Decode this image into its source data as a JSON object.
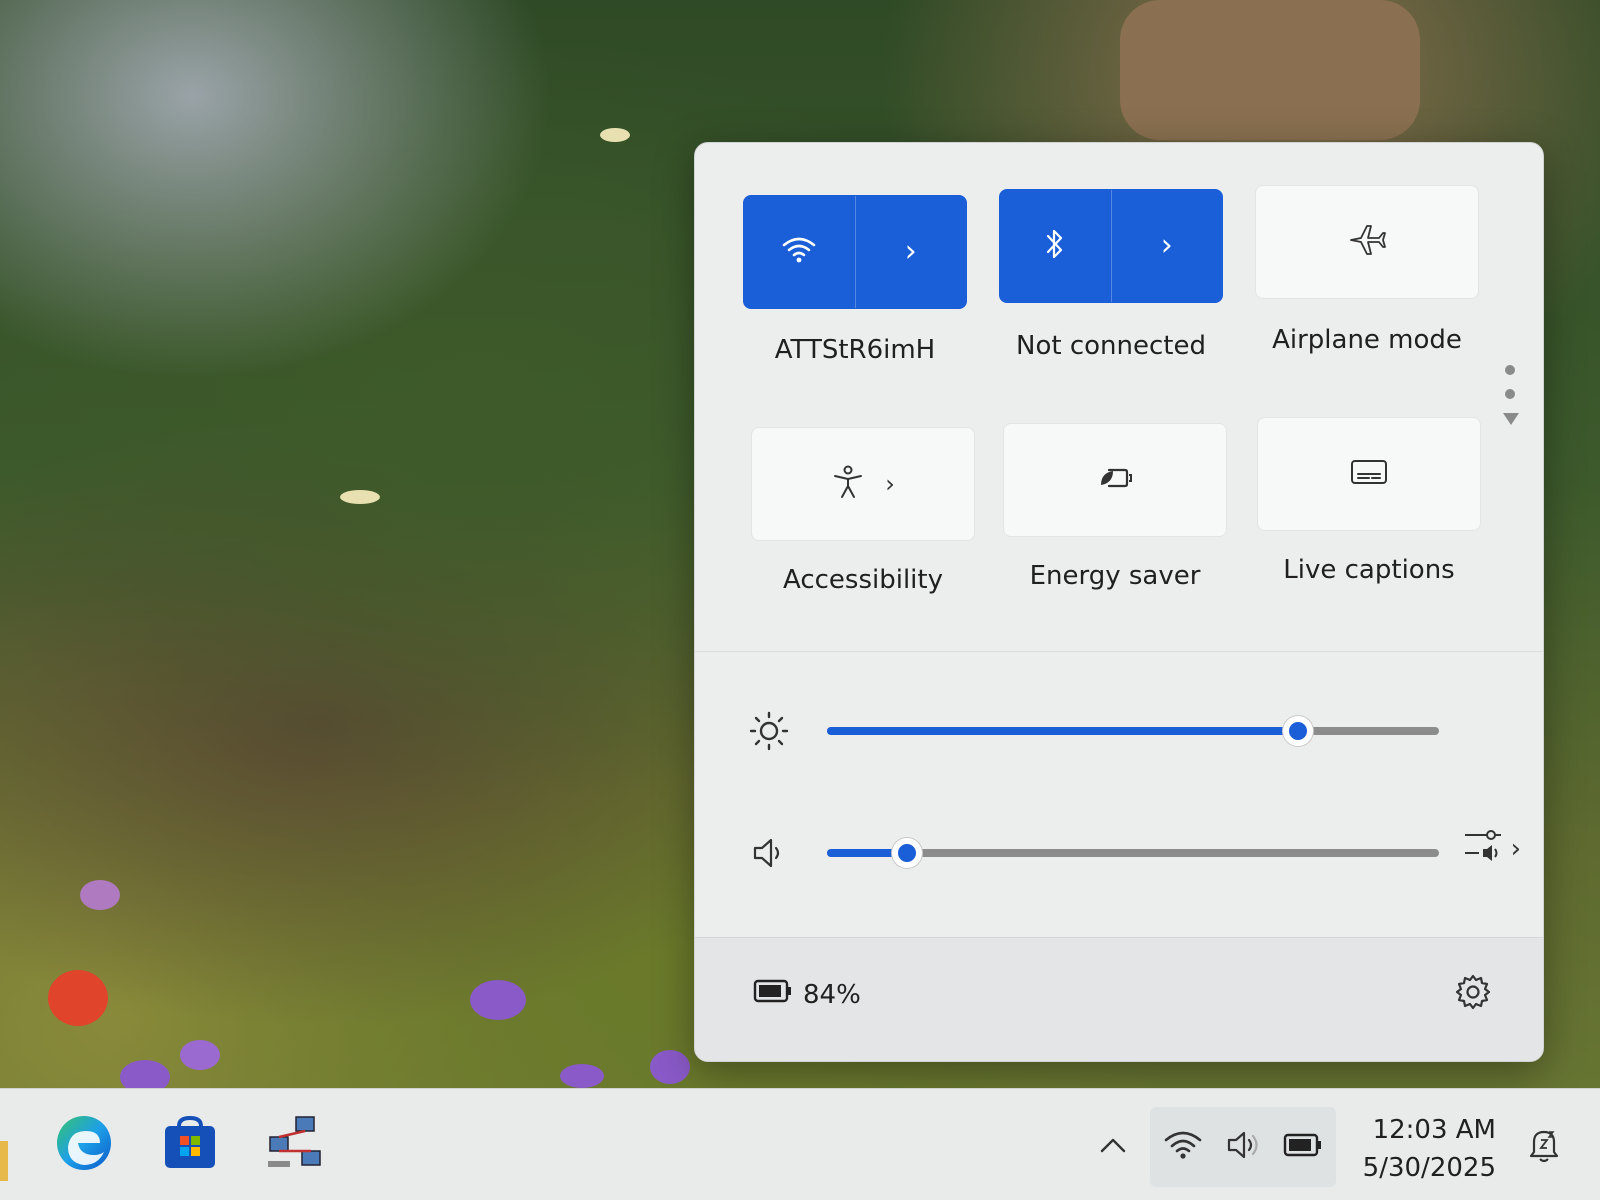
{
  "quick_settings": {
    "tiles": [
      {
        "id": "wifi",
        "label": "ATTStR6imH",
        "active": true,
        "icon": "wifi-icon",
        "expandable": true
      },
      {
        "id": "bluetooth",
        "label": "Not connected",
        "active": true,
        "icon": "bluetooth-icon",
        "expandable": true
      },
      {
        "id": "airplane",
        "label": "Airplane mode",
        "active": false,
        "icon": "airplane-icon",
        "expandable": false
      },
      {
        "id": "accessibility",
        "label": "Accessibility",
        "active": false,
        "icon": "accessibility-icon",
        "expandable": true
      },
      {
        "id": "energy_saver",
        "label": "Energy saver",
        "active": false,
        "icon": "energy-saver-icon",
        "expandable": false
      },
      {
        "id": "live_captions",
        "label": "Live captions",
        "active": false,
        "icon": "live-captions-icon",
        "expandable": false
      }
    ],
    "brightness": {
      "icon": "brightness-icon",
      "value_percent": 77
    },
    "volume": {
      "icon": "speaker-icon",
      "value_percent": 13
    },
    "footer": {
      "battery_text": "84%",
      "battery_icon": "battery-icon",
      "settings_icon": "gear-icon"
    }
  },
  "taskbar": {
    "apps": [
      "edge-icon",
      "store-icon",
      "network-app-icon"
    ],
    "tray": [
      "chevron-up-icon",
      "wifi-icon",
      "speaker-icon",
      "battery-icon"
    ],
    "time": "12:03 AM",
    "date": "5/30/2025",
    "notification_icon": "notifications-snooze-icon"
  },
  "colors": {
    "accent": "#1a5fd8",
    "panel": "#eceeee"
  }
}
